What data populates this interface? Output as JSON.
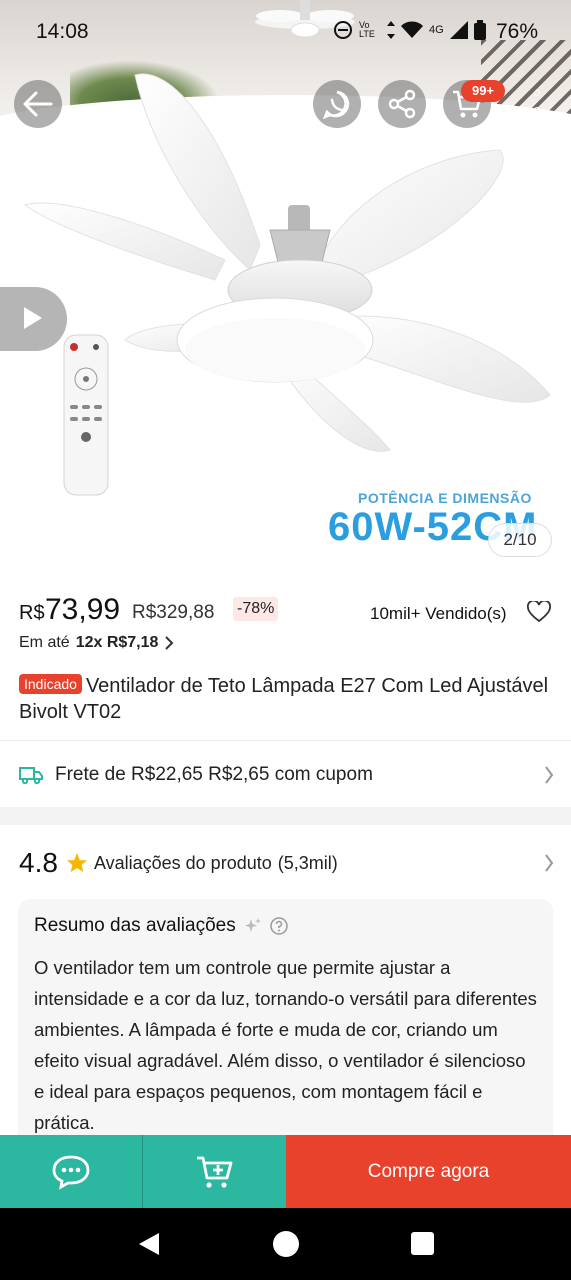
{
  "status_bar": {
    "time": "14:08",
    "network": "4G",
    "volte": "Vo LTE",
    "battery": "76%"
  },
  "top_actions": {
    "cart_badge": "99+"
  },
  "gallery": {
    "spec_label": "POTÊNCIA E DIMENSÃO",
    "spec_value": "60W-52CM",
    "counter": "2/10"
  },
  "price": {
    "currency": "R$",
    "current": "73,99",
    "original": "R$329,88",
    "discount": "-78%",
    "sold": "10mil+ Vendido(s)",
    "installment_prefix": "Em até",
    "installment_value": "12x R$7,18"
  },
  "product": {
    "tag": "Indicado",
    "title": "Ventilador de Teto Lâmpada E27 Com Led Ajustável Bivolt VT02"
  },
  "shipping": {
    "label": "Frete de R$22,65 R$2,65 com cupom"
  },
  "reviews": {
    "rating": "4.8",
    "label": "Avaliações do produto",
    "count": "(5,3mil)",
    "summary_title": "Resumo das avaliações",
    "summary_text": "O ventilador tem um controle que permite ajustar a intensidade e a cor da luz, tornando-o versátil para diferentes ambientes. A lâmpada é forte e muda de cor, criando um efeito visual agradável. Além disso, o ventilador é silencioso e ideal para espaços pequenos, com montagem fácil e prática."
  },
  "bottom_bar": {
    "buy_label": "Compre agora"
  },
  "colors": {
    "accent": "#e8412c",
    "teal": "#2bb7a0",
    "spec_blue": "#2b9ee0"
  }
}
